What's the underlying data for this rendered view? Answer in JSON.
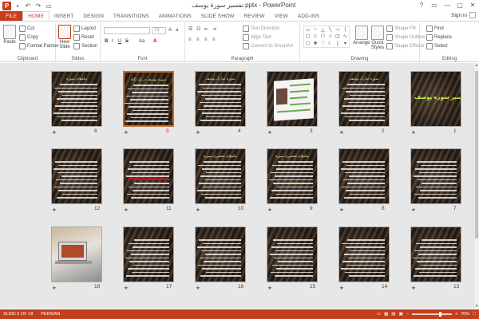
{
  "window": {
    "title": "تفسیر سورهٔ یوسف.pptx - PowerPoint",
    "controls": [
      "?",
      "▭",
      "—",
      "▢",
      "✕"
    ]
  },
  "quick_access": [
    "save-icon",
    "undo-icon",
    "redo-icon",
    "start-slideshow-icon"
  ],
  "tabs": [
    {
      "label": "FILE"
    },
    {
      "label": "HOME"
    },
    {
      "label": "INSERT"
    },
    {
      "label": "DESIGN"
    },
    {
      "label": "TRANSITIONS"
    },
    {
      "label": "ANIMATIONS"
    },
    {
      "label": "SLIDE SHOW"
    },
    {
      "label": "REVIEW"
    },
    {
      "label": "VIEW"
    },
    {
      "label": "ADD-INS"
    }
  ],
  "account": {
    "label": "Sign in"
  },
  "ribbon": {
    "clipboard": {
      "label": "Clipboard",
      "paste": "Paste",
      "cut": "Cut",
      "copy": "Copy",
      "format_painter": "Format Painter"
    },
    "slides": {
      "label": "Slides",
      "new_slide": "New Slide",
      "layout": "Layout",
      "reset": "Reset",
      "section": "Section"
    },
    "font": {
      "label": "Font",
      "size": "72",
      "bold": "B",
      "italic": "I",
      "underline": "U",
      "strike": "S",
      "case": "Aa",
      "color": "A"
    },
    "paragraph": {
      "label": "Paragraph",
      "text_direction": "Text Direction",
      "align_text": "Align Text",
      "convert_smartart": "Convert to SmartArt"
    },
    "drawing": {
      "label": "Drawing",
      "arrange": "Arrange",
      "quick_styles": "Quick Styles",
      "shape_fill": "Shape Fill",
      "shape_outline": "Shape Outline",
      "shape_effects": "Shape Effects"
    },
    "editing": {
      "label": "Editing",
      "find": "Find",
      "replace": "Replace",
      "select": "Select"
    }
  },
  "slides": [
    {
      "number": "1",
      "title": "",
      "kind": "title",
      "big_title": "تفسير سوره يوسف"
    },
    {
      "number": "2",
      "title": "سوره مبارک یوسف",
      "kind": "text"
    },
    {
      "number": "3",
      "title": "",
      "kind": "card"
    },
    {
      "number": "4",
      "title": "سوره مبارک یوسف",
      "kind": "text"
    },
    {
      "number": "5",
      "title": "سوره یوسف در یک نگاه",
      "kind": "text",
      "selected": true
    },
    {
      "number": "6",
      "title": "پیام‌های سوره",
      "kind": "text"
    },
    {
      "number": "7",
      "title": "",
      "kind": "text"
    },
    {
      "number": "8",
      "title": "",
      "kind": "text"
    },
    {
      "number": "9",
      "title": "پیام‌های تفسیری سوره",
      "kind": "text"
    },
    {
      "number": "10",
      "title": "پیام‌های تفسیری سوره",
      "kind": "text"
    },
    {
      "number": "11",
      "title": "",
      "kind": "band"
    },
    {
      "number": "12",
      "title": "",
      "kind": "text"
    },
    {
      "number": "13",
      "title": "",
      "kind": "text"
    },
    {
      "number": "14",
      "title": "",
      "kind": "text"
    },
    {
      "number": "15",
      "title": "",
      "kind": "text"
    },
    {
      "number": "16",
      "title": "",
      "kind": "text"
    },
    {
      "number": "17",
      "title": "",
      "kind": "text"
    },
    {
      "number": "18",
      "title": "",
      "kind": "photo"
    }
  ],
  "status": {
    "slide_counter": "SLIDE 5 OF 18",
    "language": "PERSIAN",
    "zoom": "70%"
  }
}
